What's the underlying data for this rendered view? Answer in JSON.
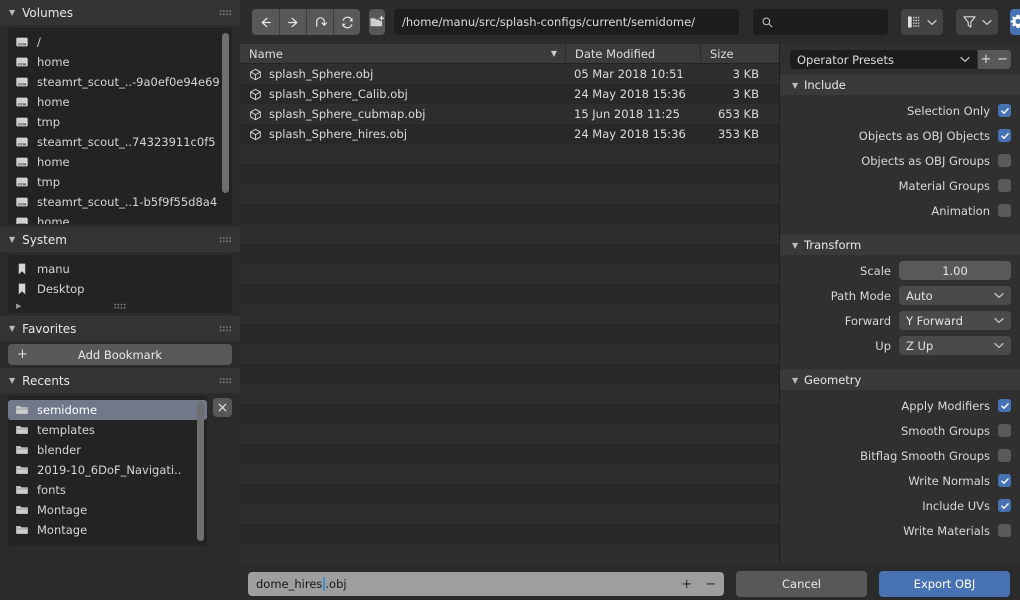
{
  "toolbar": {
    "back_label": "back-arrow",
    "forward_label": "forward-arrow",
    "up_label": "up-arrow",
    "refresh_label": "refresh",
    "new_folder_label": "new-folder",
    "path_value": "/home/manu/src/splash-configs/current/semidome/",
    "search_placeholder": "",
    "search_value": "",
    "display_mode_label": "",
    "filter_label": "",
    "settings_label": ""
  },
  "sidebar": {
    "volumes": {
      "title": "Volumes",
      "items": [
        {
          "label": "/",
          "icon": "disk-icon"
        },
        {
          "label": "home",
          "icon": "disk-icon"
        },
        {
          "label": "steamrt_scout_..-9a0ef0e94e69",
          "icon": "disk-icon"
        },
        {
          "label": "home",
          "icon": "disk-icon"
        },
        {
          "label": "tmp",
          "icon": "disk-icon"
        },
        {
          "label": "steamrt_scout_..74323911c0f5",
          "icon": "disk-icon"
        },
        {
          "label": "home",
          "icon": "disk-icon"
        },
        {
          "label": "tmp",
          "icon": "disk-icon"
        },
        {
          "label": "steamrt_scout_..1-b5f9f55d8a4",
          "icon": "disk-icon"
        },
        {
          "label": "home",
          "icon": "disk-icon"
        }
      ]
    },
    "system": {
      "title": "System",
      "items": [
        {
          "label": "manu",
          "icon": "bookmark-icon"
        },
        {
          "label": "Desktop",
          "icon": "bookmark-icon"
        }
      ]
    },
    "favorites": {
      "title": "Favorites",
      "add_bookmark_label": "Add Bookmark"
    },
    "recents": {
      "title": "Recents",
      "clear_label": "×",
      "items": [
        {
          "label": "semidome",
          "icon": "folder-icon",
          "selected": true
        },
        {
          "label": "templates",
          "icon": "folder-icon",
          "selected": false
        },
        {
          "label": "blender",
          "icon": "folder-icon",
          "selected": false
        },
        {
          "label": "2019-10_6DoF_Navigati..",
          "icon": "folder-icon",
          "selected": false
        },
        {
          "label": "fonts",
          "icon": "folder-icon",
          "selected": false
        },
        {
          "label": "Montage",
          "icon": "folder-icon",
          "selected": false
        },
        {
          "label": "Montage",
          "icon": "folder-icon",
          "selected": false
        }
      ]
    }
  },
  "filelist": {
    "columns": {
      "name": "Name",
      "date": "Date Modified",
      "size": "Size"
    },
    "sort_indicator": "▼",
    "rows": [
      {
        "name": "splash_Sphere.obj",
        "date": "05 Mar 2018 10:51",
        "size": "3 KB",
        "icon": "mesh-icon"
      },
      {
        "name": "splash_Sphere_Calib.obj",
        "date": "24 May 2018 15:36",
        "size": "3 KB",
        "icon": "mesh-icon"
      },
      {
        "name": "splash_Sphere_cubmap.obj",
        "date": "15 Jun 2018 11:25",
        "size": "653 KB",
        "icon": "mesh-icon"
      },
      {
        "name": "splash_Sphere_hires.obj",
        "date": "24 May 2018 15:36",
        "size": "353 KB",
        "icon": "mesh-icon"
      }
    ]
  },
  "options": {
    "preset": {
      "value": "Operator Presets",
      "add_label": "+",
      "remove_label": "−"
    },
    "include": {
      "title": "Include",
      "items": [
        {
          "label": "Selection Only",
          "checked": true
        },
        {
          "label": "Objects as OBJ Objects",
          "checked": true
        },
        {
          "label": "Objects as OBJ Groups",
          "checked": false
        },
        {
          "label": "Material Groups",
          "checked": false
        },
        {
          "label": "Animation",
          "checked": false
        }
      ]
    },
    "transform": {
      "title": "Transform",
      "scale_label": "Scale",
      "scale_value": "1.00",
      "path_mode_label": "Path Mode",
      "path_mode_value": "Auto",
      "forward_label": "Forward",
      "forward_value": "Y Forward",
      "up_label": "Up",
      "up_value": "Z Up"
    },
    "geometry": {
      "title": "Geometry",
      "items": [
        {
          "label": "Apply Modifiers",
          "checked": true
        },
        {
          "label": "Smooth Groups",
          "checked": false
        },
        {
          "label": "Bitflag Smooth Groups",
          "checked": false
        },
        {
          "label": "Write Normals",
          "checked": true
        },
        {
          "label": "Include UVs",
          "checked": true
        },
        {
          "label": "Write Materials",
          "checked": false
        }
      ]
    }
  },
  "bottom": {
    "filename_value": "dome_hires",
    "filename_suffix": ".obj",
    "increment_label": "+",
    "decrement_label": "−",
    "cancel_label": "Cancel",
    "export_label": "Export OBJ"
  },
  "colors": {
    "accent_blue": "#4772b3",
    "panel_bg": "#303030",
    "window_bg": "#2b2b2b",
    "field_dark": "#1d1d1d",
    "selection": "#71788a"
  }
}
